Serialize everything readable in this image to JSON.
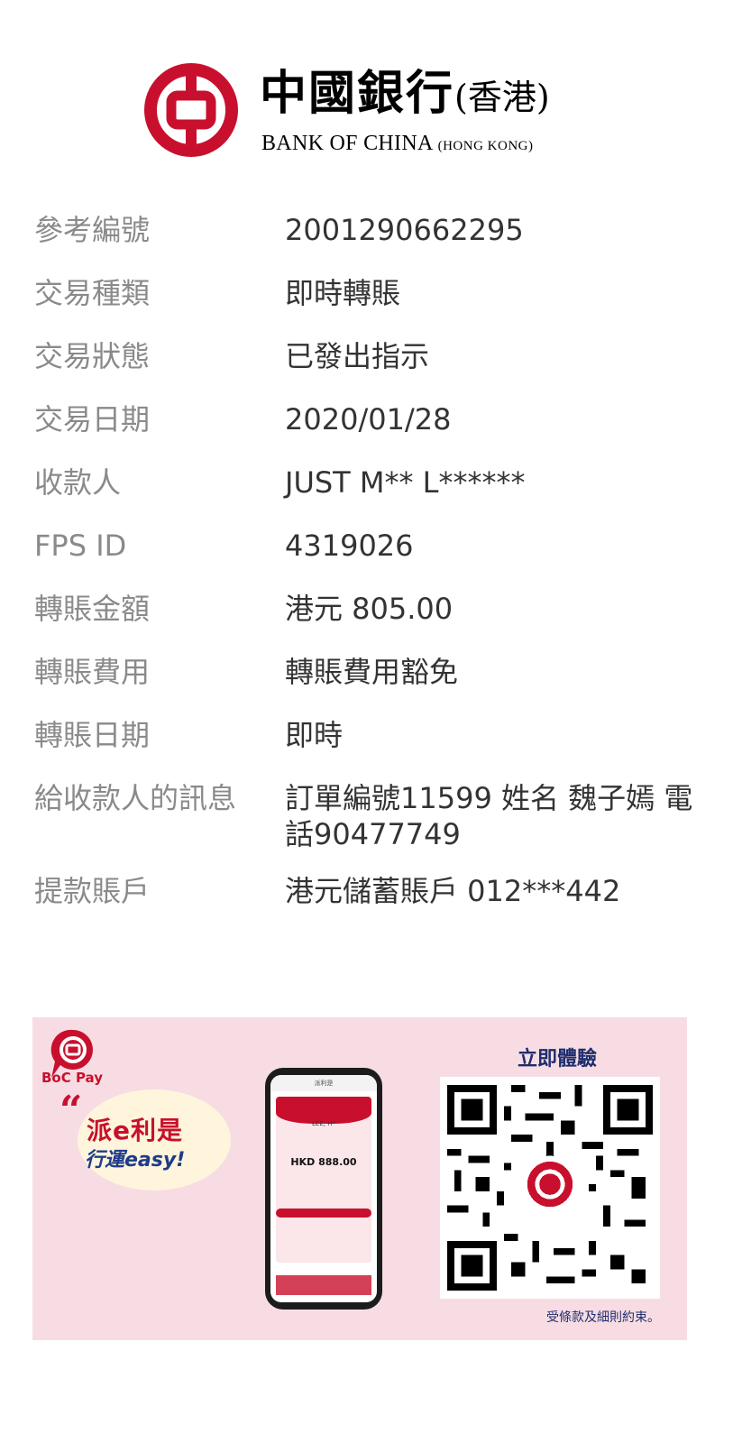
{
  "header": {
    "bank_name_cn": "中國銀行",
    "bank_region_cn": "(香港)",
    "bank_name_en": "BANK OF CHINA",
    "bank_region_en": "(HONG KONG)",
    "brand_color": "#c8102e"
  },
  "details": [
    {
      "label": "參考編號",
      "value": "2001290662295"
    },
    {
      "label": "交易種類",
      "value": "即時轉賬"
    },
    {
      "label": "交易狀態",
      "value": "已發出指示"
    },
    {
      "label": "交易日期",
      "value": "2020/01/28"
    },
    {
      "label": "收款人",
      "value": "JUST M** L******"
    },
    {
      "label": "FPS ID",
      "value": "4319026"
    },
    {
      "label": "轉賬金額",
      "value": "港元 805.00"
    },
    {
      "label": "轉賬費用",
      "value": "轉賬費用豁免"
    },
    {
      "label": "轉賬日期",
      "value": "即時"
    },
    {
      "label": "給收款人的訊息",
      "value": "訂單編號11599 姓名 魏子嫣 電話90477749"
    },
    {
      "label": "提款賬戶",
      "value": "港元儲蓄賬戶 012***442"
    }
  ],
  "promo": {
    "brand": "BoC Pay",
    "slogan_line1": "派e利是",
    "slogan_line2": "行運easy!",
    "phone_title": "派利是",
    "phone_name": "LEE, H*",
    "phone_amount": "HKD 888.00",
    "qr_title": "立即體驗",
    "terms": "受條款及細則約束。",
    "icons": [
      "boc-logo-icon",
      "boc-pay-icon",
      "qr-code-icon"
    ]
  }
}
